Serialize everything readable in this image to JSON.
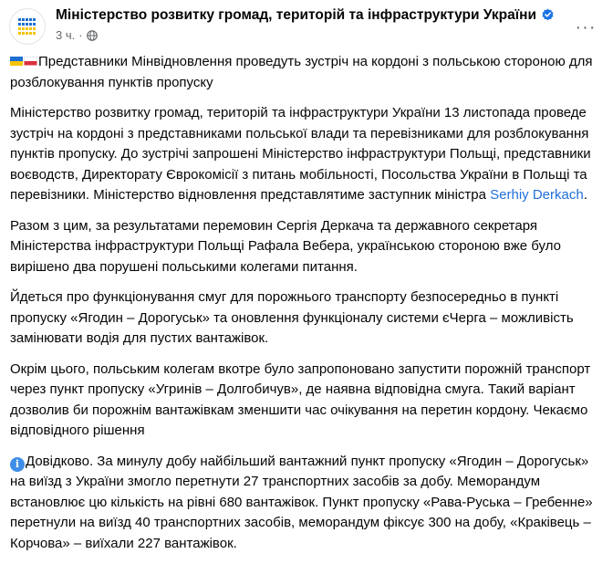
{
  "header": {
    "page_name": "Міністерство розвитку громад, територій та інфраструктури України",
    "time": "3 ч.",
    "separator": "·",
    "verified_icon": "verified-badge-icon",
    "audience_icon": "globe-icon",
    "more_label": "···"
  },
  "post": {
    "p1_text": "Представники Мінвідновлення проведуть зустріч на кордоні з польською стороною для розблокування пунктів пропуску",
    "p2_text": "Міністерство розвитку громад, територій та інфраструктури України 13 листопада проведе зустріч на кордоні з представниками польської влади та перевізниками для розблокування пунктів пропуску. До зустрічі запрошені Міністерство інфраструктури Польщі, представники воєводств, Директорату Єврокомісії з питань мобільності, Посольства України в Польщі та перевізники. Міністерство відновлення представлятиме заступник міністра ",
    "p2_link": "Serhiy Derkach",
    "p2_end": ".",
    "p3_text": "Разом з цим, за результатами перемовин Сергія Деркача та державного секретаря Міністерства інфраструктури Польщі Рафала Вебера, українською стороною вже було вирішено два порушені польськими колегами питання.",
    "p4_text": "Йдеться про функціонування смуг для порожнього транспорту безпосередньо в пункті пропуску «Ягодин – Дорогуськ» та оновлення функціоналу системи єЧерга – можливість замінювати водія для пустих вантажівок.",
    "p5_text": "Окрім цього, польським  колегам вкотре було запропоновано запустити порожній транспорт через пункт пропуску «Угринів – Долгобичув», де наявна відповідна смуга. Такий варіант дозволив би порожнім вантажівкам зменшити час очікування на перетин кордону. Чекаємо відповідного рішення",
    "p6_text": "Довідково. За минулу добу найбільший вантажний пункт пропуску «Ягодин – Дорогуськ» на виїзд з України змогло перетнути 27 транспортних засобів за добу. Меморандум встановлює цю кількість на рівні 680 вантажівок. Пункт пропуску «Рава-Руська – Гребенне» перетнули на виїзд 40 транспортних засобів, меморандум фіксує 300 на добу, «Краківець – Корчова» – виїхали 227 вантажівок.",
    "info_icon_glyph": "i"
  },
  "colors": {
    "text": "#050505",
    "secondary": "#65676b",
    "link": "#216fdb",
    "verified": "#1b74e4"
  }
}
